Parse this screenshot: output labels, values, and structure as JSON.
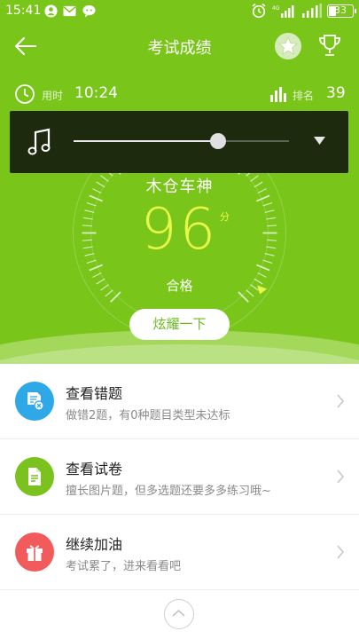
{
  "status_bar": {
    "time": "15:41",
    "battery": "33",
    "battery_level": 0.33
  },
  "header": {
    "title": "考试成绩"
  },
  "info": {
    "time_label": "用时",
    "time_value": "10:24",
    "rank_label": "排名",
    "rank_value": "39"
  },
  "score_card": {
    "title": "木仓车神",
    "score": "96",
    "unit": "分",
    "result": "合格",
    "share_button": "炫耀一下"
  },
  "media_player": {
    "progress": 0.67
  },
  "list": [
    {
      "title": "查看错题",
      "subtitle": "做错2题，有0种题目类型未达标",
      "icon": "error-list-icon",
      "color": "#2fa8e8"
    },
    {
      "title": "查看试卷",
      "subtitle": "擅长图片题，但多选题还要多多练习哦~",
      "icon": "document-icon",
      "color": "#7cc21e"
    },
    {
      "title": "继续加油",
      "subtitle": "考试累了，进来看看吧",
      "icon": "gift-icon",
      "color": "#f15b5b"
    }
  ],
  "colors": {
    "theme_green": "#79c51a",
    "score_yellow": "#e9f94a"
  }
}
